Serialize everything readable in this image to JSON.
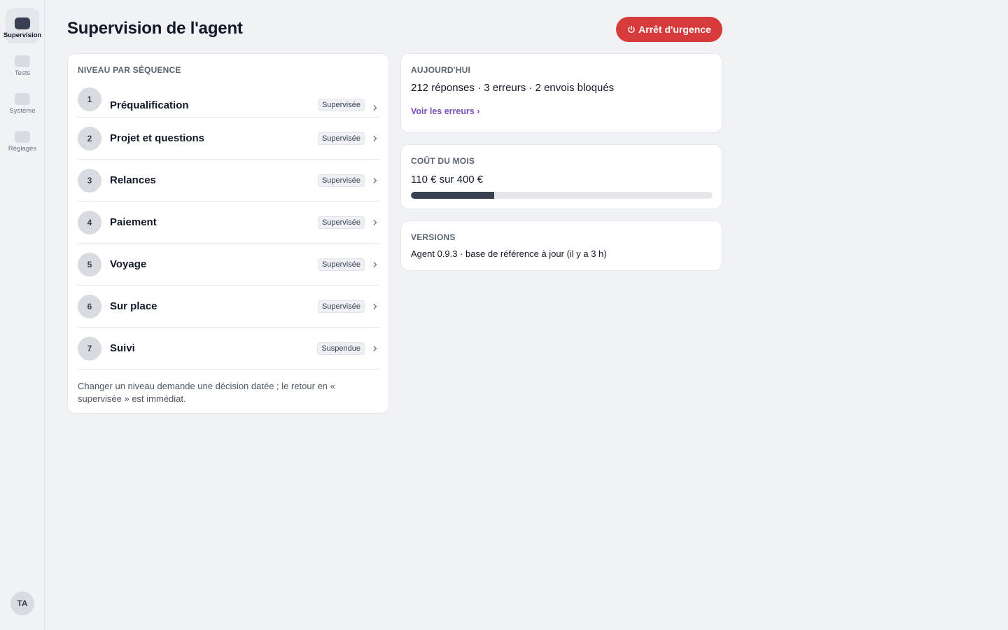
{
  "sidebar": {
    "items": [
      {
        "label": "Supervision",
        "icon": "supervision-icon",
        "active": true
      },
      {
        "label": "Tests",
        "icon": "tests-icon",
        "active": false
      },
      {
        "label": "Système",
        "icon": "system-icon",
        "active": false
      },
      {
        "label": "Réglages",
        "icon": "settings-icon",
        "active": false
      }
    ],
    "avatar": "TA"
  },
  "header": {
    "title": "Supervision de l'agent",
    "emergency_label": "Arrêt d'urgence",
    "emergency_icon": "power-icon"
  },
  "sequences": {
    "title": "NIVEAU PAR SÉQUENCE",
    "items": [
      {
        "number": "1",
        "name": "Préqualification",
        "status": "Supervisée"
      },
      {
        "number": "2",
        "name": "Projet et questions",
        "status": "Supervisée"
      },
      {
        "number": "3",
        "name": "Relances",
        "status": "Supervisée"
      },
      {
        "number": "4",
        "name": "Paiement",
        "status": "Supervisée"
      },
      {
        "number": "5",
        "name": "Voyage",
        "status": "Supervisée"
      },
      {
        "number": "6",
        "name": "Sur place",
        "status": "Supervisée"
      },
      {
        "number": "7",
        "name": "Suivi",
        "status": "Suspendue"
      }
    ],
    "note": "Changer un niveau demande une décision datée ; le retour en « supervisée » est immédiat."
  },
  "today": {
    "title": "AUJOURD'HUI",
    "stats": "212 réponses · 3 erreurs · 2 envois bloqués",
    "link": "Voir les erreurs ›"
  },
  "cost": {
    "title": "COÛT DU MOIS",
    "value": "110 € sur 400 €",
    "progress": 0.275
  },
  "versions": {
    "title": "VERSIONS",
    "text": "Agent 0.9.3 · base de référence à jour (il y a 3 h)"
  },
  "colors": {
    "accent": "#d63a3a",
    "link": "#7c4dbd",
    "progress": "#374151"
  }
}
